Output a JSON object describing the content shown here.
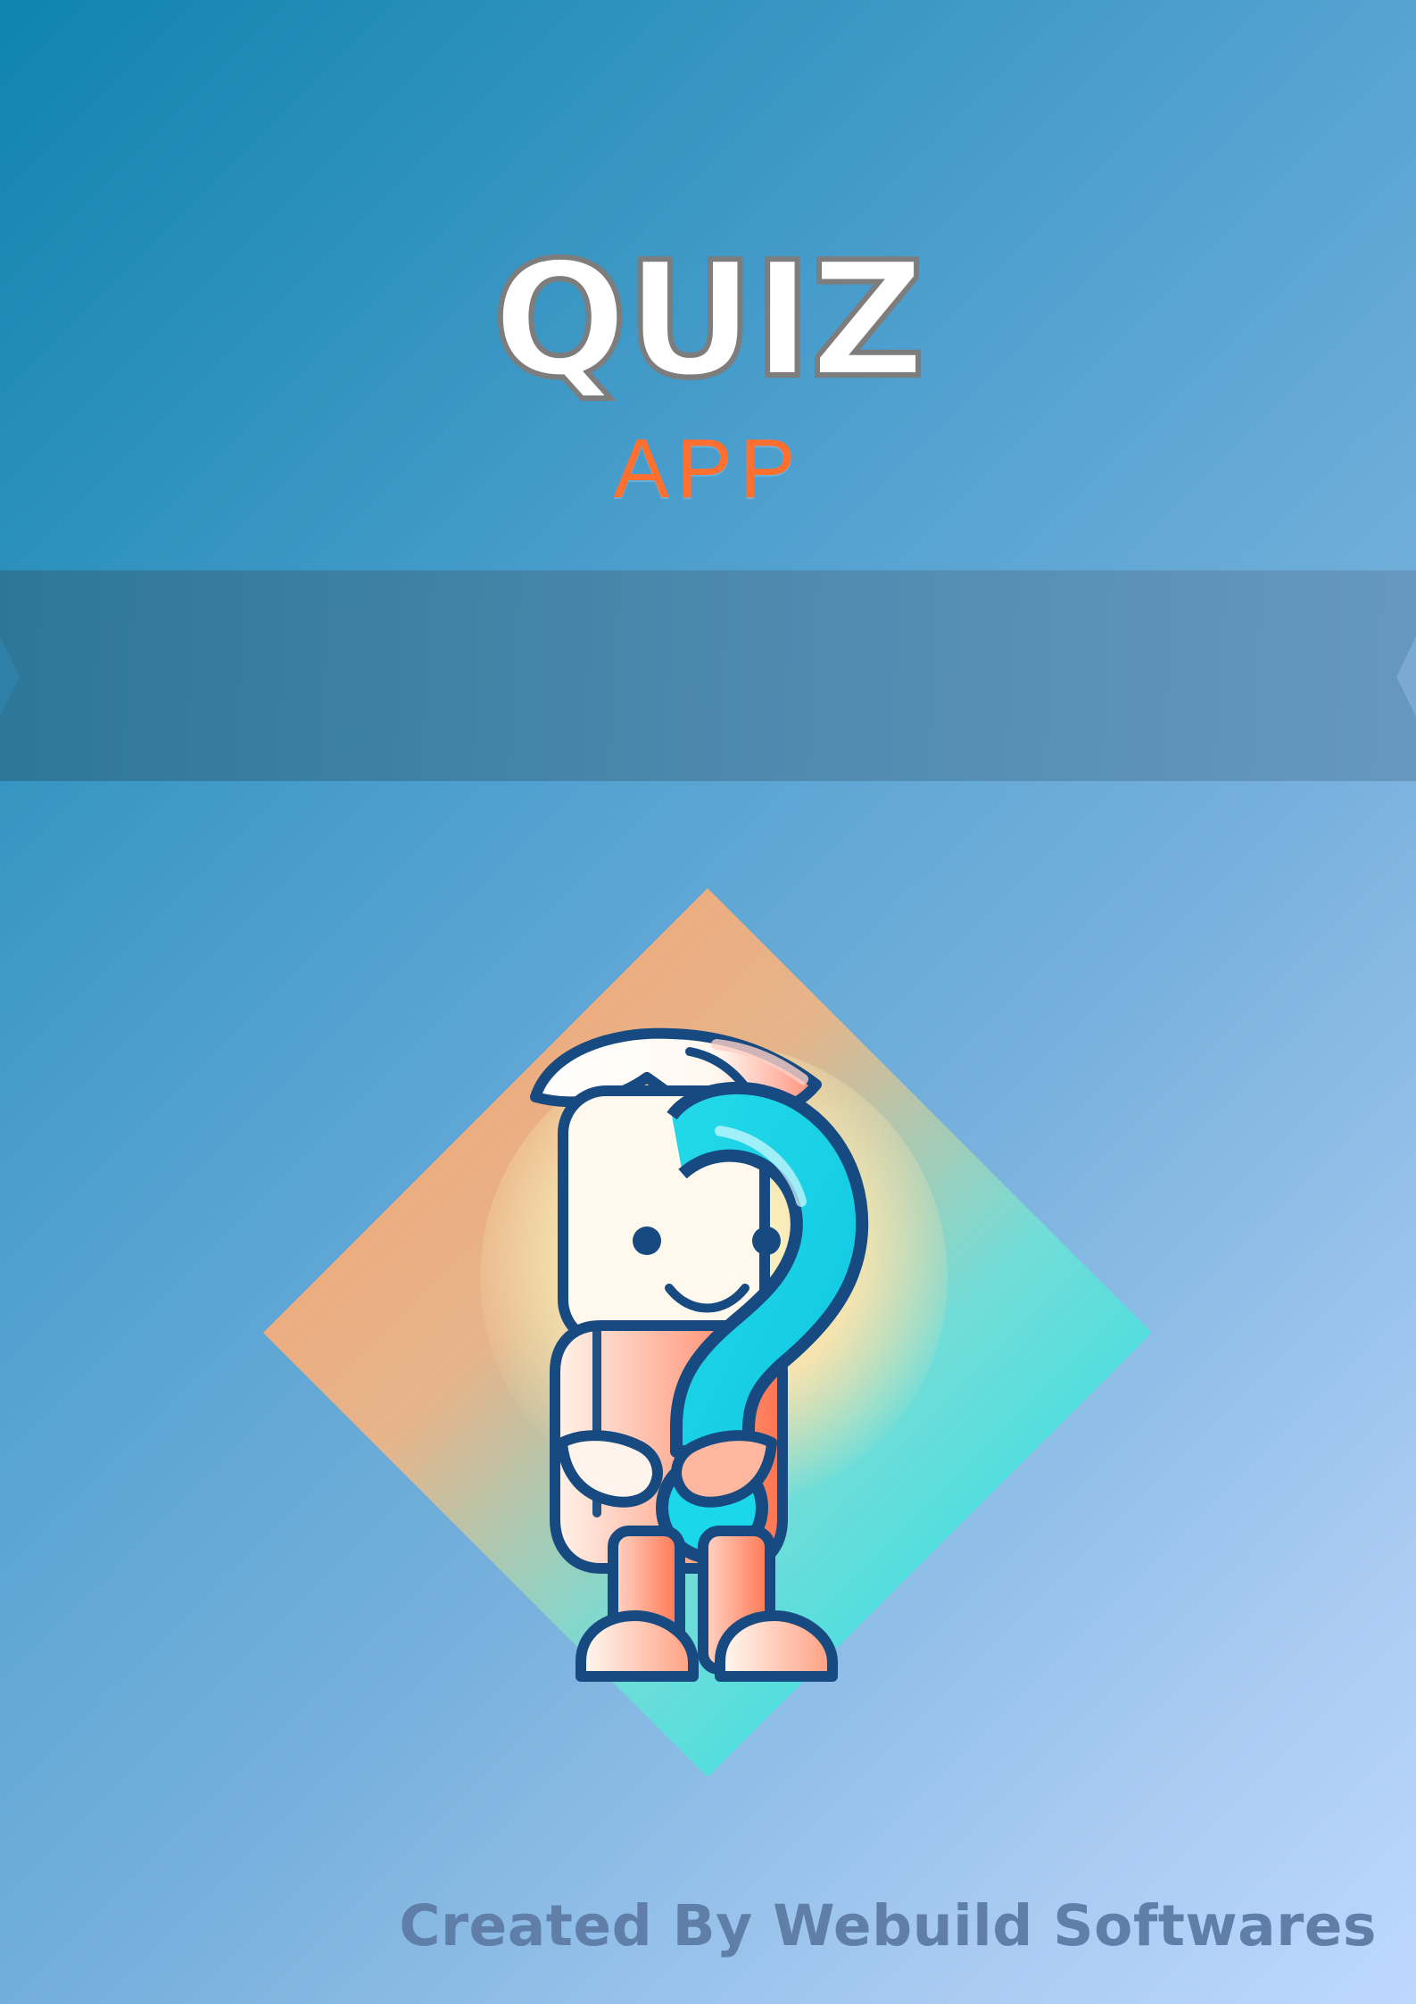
{
  "hero": {
    "title": "QUIZ",
    "subtitle": "APP"
  },
  "illustration": {
    "name": "question-mark-mascot-icon"
  },
  "footer": {
    "credit": "Created By Webuild Softwares"
  },
  "colors": {
    "title_fill": "#ffffff",
    "title_outline": "#7d7d7d",
    "subtitle": "#ff6f2f",
    "band": "#3f7ea3",
    "footer": "#5f7ea8",
    "logo_orange": "#f5a06f",
    "logo_cyan": "#15dfe7",
    "logo_blue": "#174a80"
  }
}
